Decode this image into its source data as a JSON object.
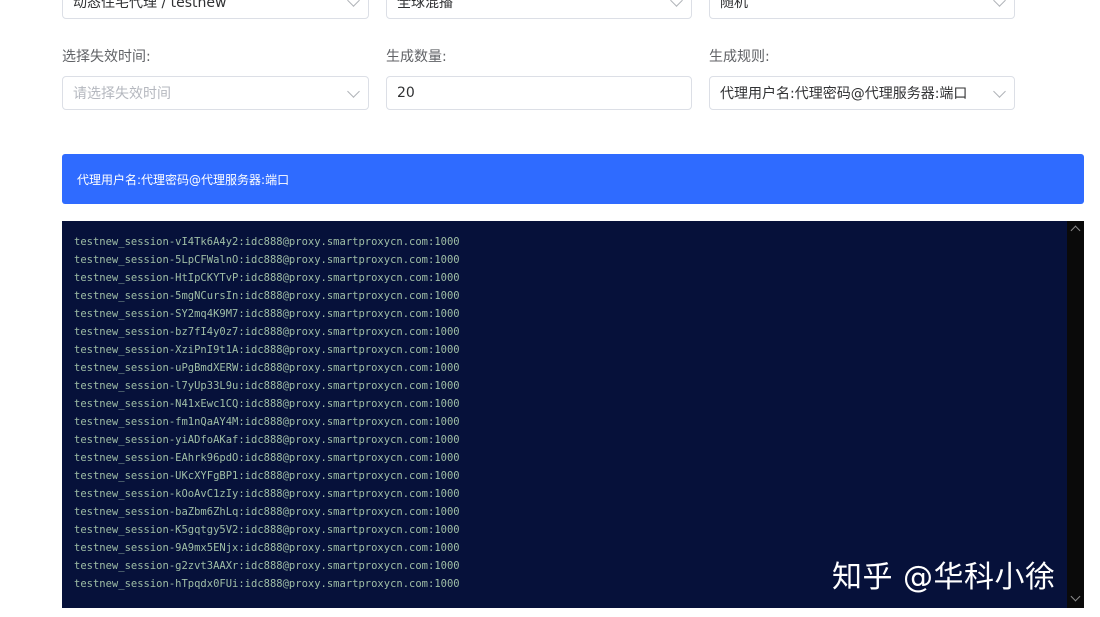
{
  "top_selects": [
    {
      "value": "动态住宅代理 / testnew"
    },
    {
      "value": "全球混播"
    },
    {
      "value": "随机"
    }
  ],
  "expiry": {
    "label": "选择失效时间:",
    "placeholder": "请选择失效时间"
  },
  "count": {
    "label": "生成数量:",
    "value": "20"
  },
  "rule": {
    "label": "生成规则:",
    "value": "代理用户名:代理密码@代理服务器:端口"
  },
  "banner": {
    "text": "代理用户名:代理密码@代理服务器:端口"
  },
  "output_lines": [
    "testnew_session-vI4Tk6A4y2:idc888@proxy.smartproxycn.com:1000",
    "testnew_session-5LpCFWalnO:idc888@proxy.smartproxycn.com:1000",
    "testnew_session-HtIpCKYTvP:idc888@proxy.smartproxycn.com:1000",
    "testnew_session-5mgNCursIn:idc888@proxy.smartproxycn.com:1000",
    "testnew_session-SY2mq4K9M7:idc888@proxy.smartproxycn.com:1000",
    "testnew_session-bz7fI4y0z7:idc888@proxy.smartproxycn.com:1000",
    "testnew_session-XziPnI9t1A:idc888@proxy.smartproxycn.com:1000",
    "testnew_session-uPgBmdXERW:idc888@proxy.smartproxycn.com:1000",
    "testnew_session-l7yUp33L9u:idc888@proxy.smartproxycn.com:1000",
    "testnew_session-N41xEwc1CQ:idc888@proxy.smartproxycn.com:1000",
    "testnew_session-fm1nQaAY4M:idc888@proxy.smartproxycn.com:1000",
    "testnew_session-yiADfoAKaf:idc888@proxy.smartproxycn.com:1000",
    "testnew_session-EAhrk96pdO:idc888@proxy.smartproxycn.com:1000",
    "testnew_session-UKcXYFgBP1:idc888@proxy.smartproxycn.com:1000",
    "testnew_session-kOoAvC1zIy:idc888@proxy.smartproxycn.com:1000",
    "testnew_session-baZbm6ZhLq:idc888@proxy.smartproxycn.com:1000",
    "testnew_session-K5gqtgy5V2:idc888@proxy.smartproxycn.com:1000",
    "testnew_session-9A9mx5ENjx:idc888@proxy.smartproxycn.com:1000",
    "testnew_session-g2zvt3AAXr:idc888@proxy.smartproxycn.com:1000",
    "testnew_session-hTpqdx0FUi:idc888@proxy.smartproxycn.com:1000"
  ],
  "watermark": "知乎 @华科小徐",
  "colors": {
    "banner": "#2f6bff",
    "terminal_bg": "#06113a",
    "terminal_text": "#9fbea6"
  }
}
